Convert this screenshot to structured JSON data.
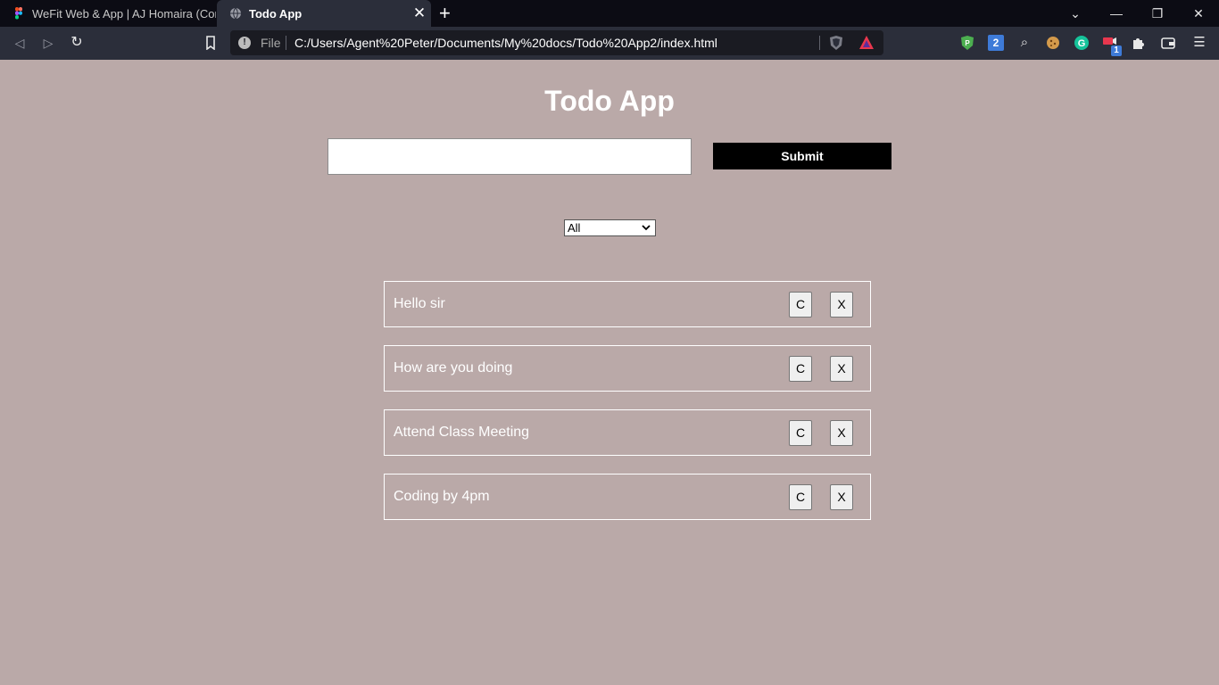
{
  "browser": {
    "tabs": [
      {
        "title": "WeFit Web & App | AJ Homaira (Comm",
        "active": false
      },
      {
        "title": "Todo App",
        "active": true
      }
    ],
    "new_tab_label": "+",
    "url_scheme": "File",
    "url": "C:/Users/Agent%20Peter/Documents/My%20docs/Todo%20App2/index.html",
    "extension_badges": {
      "counter_extension": "2",
      "notification_count": "1"
    }
  },
  "app": {
    "title": "Todo App",
    "input_value": "",
    "submit_label": "Submit",
    "filter": {
      "selected": "All"
    },
    "todos": [
      {
        "text": "Hello sir",
        "complete_label": "C",
        "delete_label": "X"
      },
      {
        "text": "How are you doing",
        "complete_label": "C",
        "delete_label": "X"
      },
      {
        "text": "Attend Class Meeting",
        "complete_label": "C",
        "delete_label": "X"
      },
      {
        "text": "Coding by 4pm",
        "complete_label": "C",
        "delete_label": "X"
      }
    ]
  },
  "colors": {
    "page_background": "#baa9a8",
    "submit_background": "#000000",
    "title_color": "#ffffff",
    "chrome_background": "#2b2e3a"
  }
}
